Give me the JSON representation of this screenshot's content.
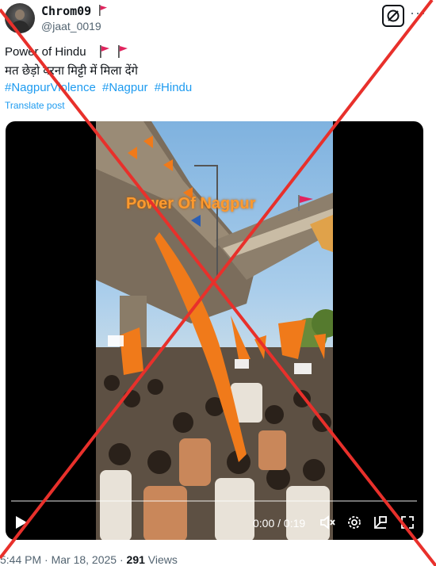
{
  "author": {
    "display_name": "Chrom09",
    "handle": "@jaat_0019",
    "avatar_icon": "profile-photo",
    "name_flag_icon": "red-flag-icon"
  },
  "header_actions": {
    "grok_icon": "grok-icon",
    "more_label": "···"
  },
  "post": {
    "line1": "Power of Hindu",
    "line2": "मत छेड़ो वरना मिट्टी में मिला देंगे",
    "hashtags": [
      "#NagpurViolence",
      "#Nagpur",
      "#Hindu"
    ],
    "translate": "Translate post"
  },
  "video": {
    "overlay_text": "Power Of Nagpur",
    "time": "0:00 / 0:19",
    "progress": 0,
    "controls": [
      "play-icon",
      "mute-icon",
      "settings-icon",
      "pip-icon",
      "fullscreen-icon"
    ]
  },
  "meta": {
    "timestamp": "5:44 PM · Mar 18, 2025 · ",
    "views_count": "291",
    "views_label": " Views"
  },
  "colors": {
    "link": "#1d9bf0",
    "flag": "#e0245e",
    "cross": "#e8302b",
    "saffron": "#f07a1a"
  }
}
